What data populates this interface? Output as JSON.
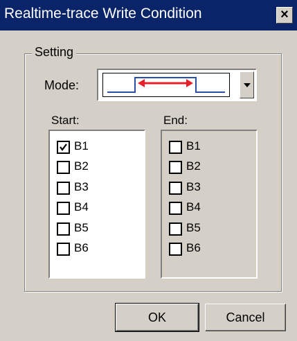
{
  "window": {
    "title": "Realtime-trace Write Condition"
  },
  "setting": {
    "group_label": "Setting",
    "mode_label": "Mode:",
    "mode_selected_icon": "window-range-icon"
  },
  "start": {
    "label": "Start:",
    "items": [
      {
        "label": "B1",
        "checked": true
      },
      {
        "label": "B2",
        "checked": false
      },
      {
        "label": "B3",
        "checked": false
      },
      {
        "label": "B4",
        "checked": false
      },
      {
        "label": "B5",
        "checked": false
      },
      {
        "label": "B6",
        "checked": false
      }
    ]
  },
  "end": {
    "label": "End:",
    "items": [
      {
        "label": "B1",
        "checked": false
      },
      {
        "label": "B2",
        "checked": false
      },
      {
        "label": "B3",
        "checked": false
      },
      {
        "label": "B4",
        "checked": false
      },
      {
        "label": "B5",
        "checked": false
      },
      {
        "label": "B6",
        "checked": false
      }
    ]
  },
  "buttons": {
    "ok": "OK",
    "cancel": "Cancel"
  },
  "colors": {
    "titlebar": "#0a246a",
    "face": "#d4d0c8",
    "range_arrow": "#e8202a",
    "waveform": "#2a4ea6"
  }
}
